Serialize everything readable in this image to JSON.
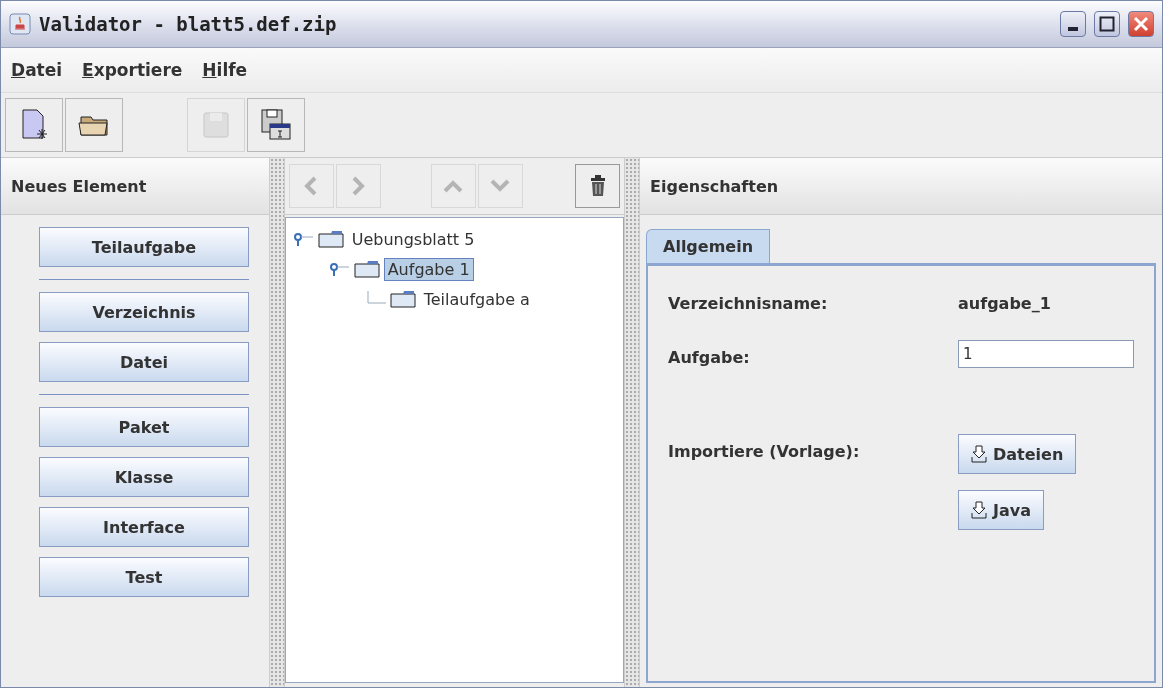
{
  "window": {
    "title": "Validator - blatt5.def.zip"
  },
  "menu": [
    "Datei",
    "Exportiere",
    "Hilfe"
  ],
  "toolbar": [
    {
      "kind": "new",
      "disabled": false
    },
    {
      "kind": "open",
      "disabled": false
    },
    {
      "kind": "gap"
    },
    {
      "kind": "save",
      "disabled": true
    },
    {
      "kind": "export",
      "disabled": false
    }
  ],
  "left_panel": {
    "title": "Neues Element",
    "groups": [
      [
        "Teilaufgabe"
      ],
      [
        "Verzeichnis",
        "Datei"
      ],
      [
        "Paket",
        "Klasse",
        "Interface",
        "Test"
      ]
    ]
  },
  "tree_toolbar": [
    {
      "kind": "back",
      "disabled": true
    },
    {
      "kind": "forward",
      "disabled": true
    },
    {
      "kind": "gap"
    },
    {
      "kind": "up",
      "disabled": true
    },
    {
      "kind": "down",
      "disabled": true
    },
    {
      "kind": "fill"
    },
    {
      "kind": "delete",
      "disabled": false
    }
  ],
  "tree": [
    {
      "label": "Uebungsblatt 5",
      "selected": false,
      "expanded": true,
      "children": [
        {
          "label": "Aufgabe 1",
          "selected": true,
          "expanded": true,
          "children": [
            {
              "label": "Teilaufgabe a",
              "selected": false
            }
          ]
        }
      ]
    }
  ],
  "properties": {
    "title": "Eigenschaften",
    "tabs": [
      {
        "label": "Allgemein",
        "selected": true
      }
    ],
    "fields": [
      {
        "kind": "text",
        "label": "Verzeichnisname:",
        "value": "aufgabe_1"
      },
      {
        "kind": "input",
        "label": "Aufgabe:",
        "value": "1"
      },
      {
        "kind": "buttons",
        "label": "Importiere (Vorlage):",
        "buttons": [
          "Dateien",
          "Java"
        ]
      }
    ]
  }
}
